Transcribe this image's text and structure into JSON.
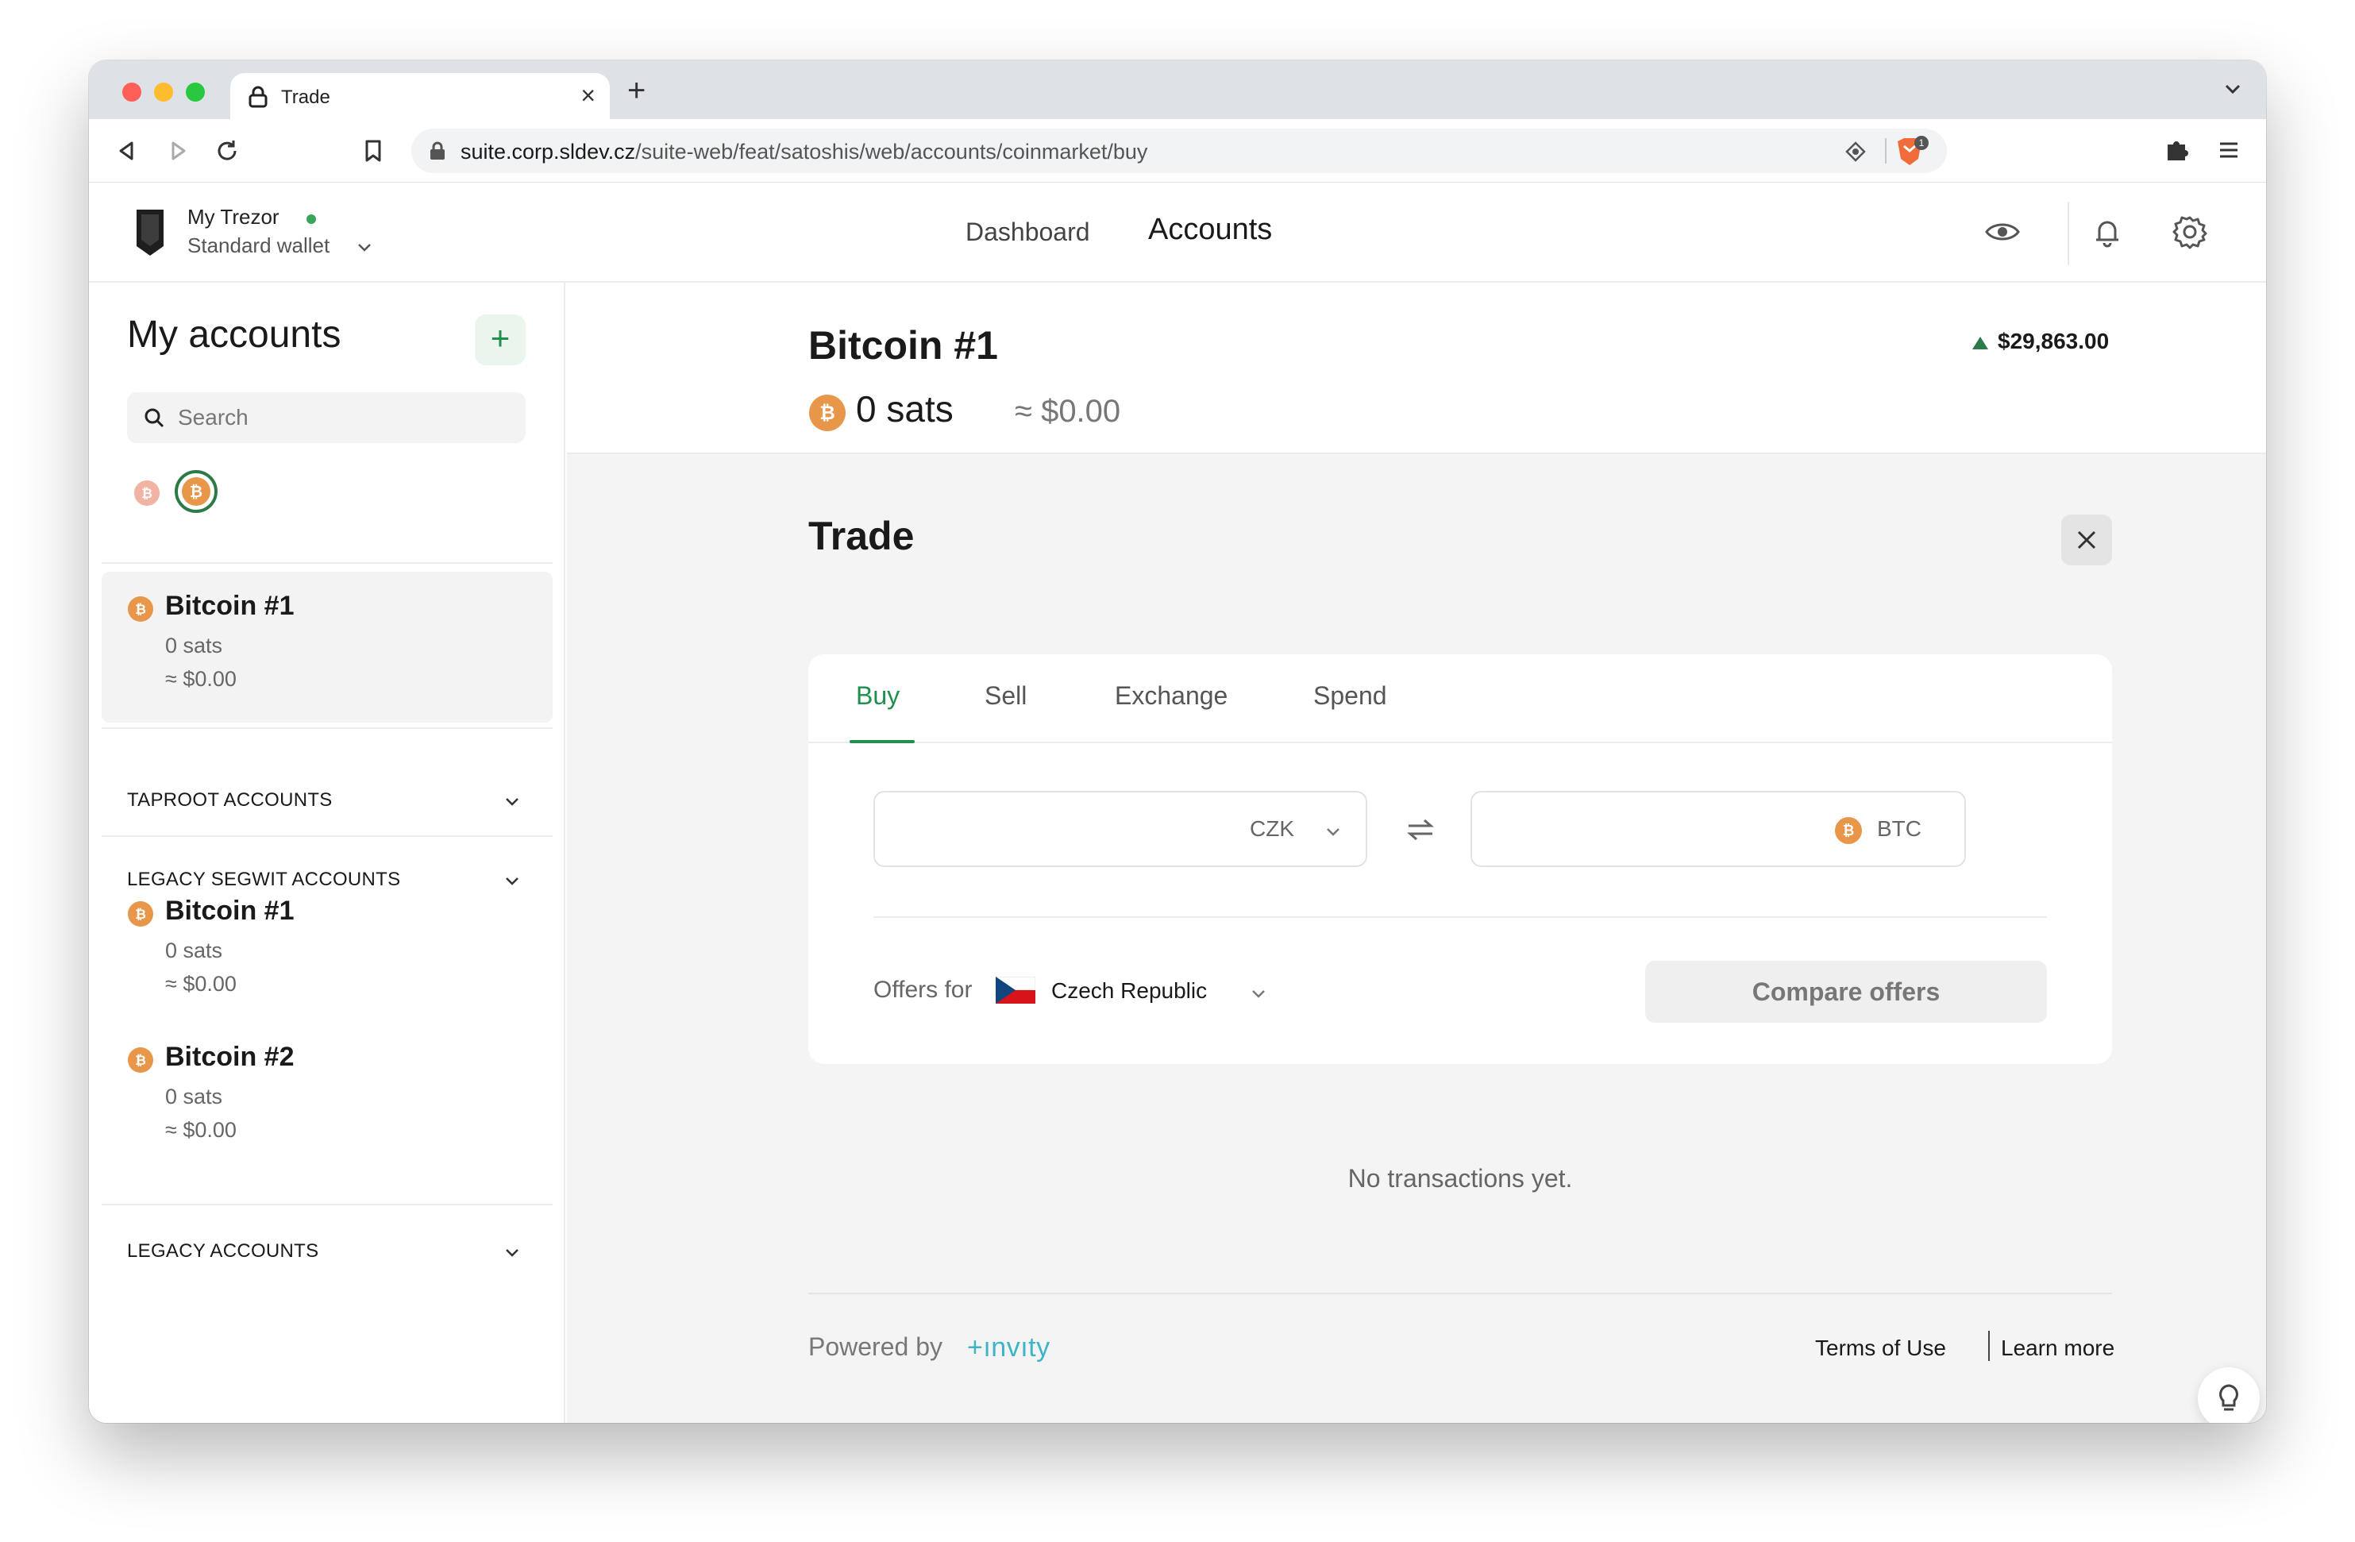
{
  "browser": {
    "tab_title": "Trade",
    "url_host": "suite.corp.sldev.cz",
    "url_path": "/suite-web/feat/satoshis/web/accounts/coinmarket/buy",
    "brave_badge": "1"
  },
  "header": {
    "device_name": "My Trezor",
    "wallet_name": "Standard wallet",
    "nav": {
      "dashboard": "Dashboard",
      "accounts": "Accounts"
    }
  },
  "sidebar": {
    "title": "My accounts",
    "add_label": "+",
    "search_placeholder": "Search",
    "accounts": [
      {
        "name": "Bitcoin #1",
        "balance": "0 sats",
        "fiat": "≈ $0.00"
      }
    ],
    "groups": {
      "taproot": "TAPROOT ACCOUNTS",
      "segwit": "LEGACY SEGWIT ACCOUNTS",
      "legacy": "LEGACY ACCOUNTS"
    },
    "segwit_accounts": [
      {
        "name": "Bitcoin #1",
        "balance": "0 sats",
        "fiat": "≈ $0.00"
      },
      {
        "name": "Bitcoin #2",
        "balance": "0 sats",
        "fiat": "≈ $0.00"
      }
    ]
  },
  "account": {
    "title": "Bitcoin #1",
    "balance": "0 sats",
    "fiat": "≈ $0.00",
    "price": "$29,863.00"
  },
  "trade": {
    "title": "Trade",
    "tabs": [
      "Buy",
      "Sell",
      "Exchange",
      "Spend"
    ],
    "fiat_currency": "CZK",
    "crypto_currency": "BTC",
    "offers_for": "Offers for",
    "country": "Czech Republic",
    "compare_button": "Compare offers",
    "no_transactions": "No transactions yet.",
    "powered_by": "Powered by",
    "provider": "+ınvıty",
    "terms": "Terms of Use",
    "learn_more": "Learn more"
  },
  "colors": {
    "accent": "#1f8f4e",
    "bitcoin": "#e8974a",
    "invity": "#3eb5c7"
  },
  "icons": {
    "coin": "bitcoin-icon",
    "add": "plus-icon",
    "search": "search-icon",
    "close": "close-icon",
    "swap": "swap-arrows-icon",
    "tip": "lightbulb-icon"
  }
}
